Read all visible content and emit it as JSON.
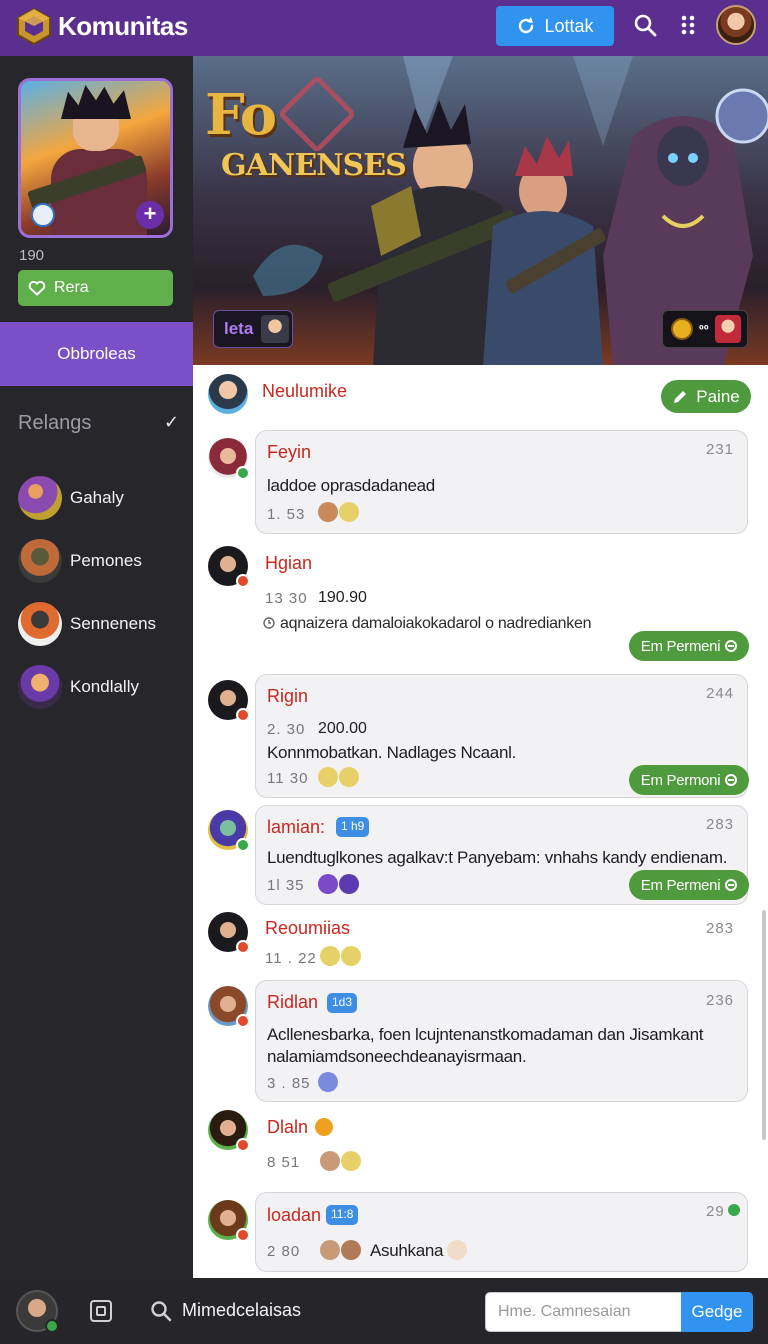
{
  "header": {
    "title": "Komunitas",
    "login_label": "Lottak",
    "icons": [
      "cube-logo-icon",
      "refresh-icon",
      "search-icon",
      "more-dots-icon"
    ]
  },
  "sidebar": {
    "count": "190",
    "follow_label": "Rera",
    "active_label": "Obbroleas",
    "section_title": "Relangs",
    "items": [
      {
        "label": "Gahaly"
      },
      {
        "label": "Pemones"
      },
      {
        "label": "Sennenens"
      },
      {
        "label": "Kondlally"
      }
    ]
  },
  "banner": {
    "title_line1": "Fo",
    "title_line2": "GANENSES",
    "tag_left": "leta",
    "tag_right": "⁰⁰"
  },
  "feed": {
    "top_user": "Neulumike",
    "post_button": "Paine",
    "posts": [
      {
        "name": "Feyin",
        "time": "231",
        "body": "laddoe oprasdadanead",
        "meta": "1.  53"
      },
      {
        "name": "Hgian",
        "stat_a": "13  30",
        "stat_b": "190.90",
        "sub": "aqnaizera damaloiakokadarol o nadredianken",
        "button": "Em Permeni"
      },
      {
        "name": "Rigin",
        "time": "244",
        "stat_a": "2. 30",
        "stat_b": "200.00",
        "body": "Konnmobatkan. Nadlages Ncaanl.",
        "meta": "11  30",
        "button": "Em Permoni"
      },
      {
        "name": "lamian:",
        "tag": "1 h9",
        "time": "283",
        "body": "Luendtuglkones agalkav:t Panyebam: vnhahs  kandy endienam.",
        "meta": "1l  35",
        "button": "Em Permeni"
      },
      {
        "name": "Reoumiias",
        "time": "283",
        "meta": "11 . 22"
      },
      {
        "name": "Ridlan",
        "tag": "1d3",
        "time": "236",
        "body_line1": "Acllenesbarka, foen lcujntenanstkomadaman dan Jisamkant",
        "body_line2": "nalamiamdsoneechdeanayisrmaan.",
        "meta": "3 . 85"
      },
      {
        "name": "Dlaln",
        "meta": "8   51"
      },
      {
        "name": "loadan",
        "tag": "11:8",
        "time": "29",
        "meta": "2   80",
        "body": "Asuhkana"
      }
    ]
  },
  "bottombar": {
    "label": "Mimedcelaisas",
    "input_placeholder": "Hme. Camnesaian",
    "send_label": "Gedge"
  },
  "colors": {
    "header_bg": "#5b2f8f",
    "sidebar_bg": "#27272b",
    "accent_purple": "#7a4fc8",
    "accent_blue": "#2f93ef",
    "accent_green": "#4e9a3c",
    "username_red": "#c8281e"
  }
}
